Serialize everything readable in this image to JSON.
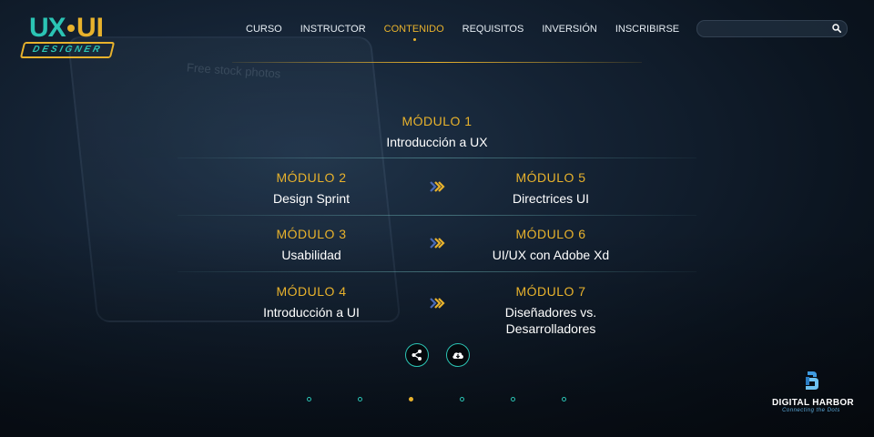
{
  "logo": {
    "ux": "UX",
    "ui": "UI",
    "designer": "DESIGNER"
  },
  "background": {
    "watermark": "Free stock photos"
  },
  "nav": {
    "items": [
      {
        "label": "CURSO"
      },
      {
        "label": "INSTRUCTOR"
      },
      {
        "label": "CONTENIDO",
        "active": true
      },
      {
        "label": "REQUISITOS"
      },
      {
        "label": "INVERSIÓN"
      },
      {
        "label": "INSCRIBIRSE"
      }
    ]
  },
  "search": {
    "value": "",
    "placeholder": "",
    "icon": "search-icon"
  },
  "modules": {
    "m1": {
      "title": "MÓDULO 1",
      "name": "Introducción a UX"
    },
    "m2": {
      "title": "MÓDULO 2",
      "name": "Design Sprint"
    },
    "m3": {
      "title": "MÓDULO 3",
      "name": "Usabilidad"
    },
    "m4": {
      "title": "MÓDULO 4",
      "name": "Introducción a UI"
    },
    "m5": {
      "title": "MÓDULO 5",
      "name": "Directrices UI"
    },
    "m6": {
      "title": "MÓDULO 6",
      "name": "UI/UX con Adobe Xd"
    },
    "m7": {
      "title": "MÓDULO 7",
      "name_line1": "Diseñadores vs.",
      "name_line2": "Desarrolladores"
    }
  },
  "actions": {
    "share_icon": "share-icon",
    "download_icon": "cloud-download-icon"
  },
  "pagination": {
    "total": 6,
    "active_index": 3
  },
  "brand": {
    "name": "DIGITAL HARBOR",
    "tagline": "Connecting the Dots"
  },
  "colors": {
    "accent": "#e8b22c",
    "teal": "#2bc4b4",
    "background": "#0e1a27"
  }
}
